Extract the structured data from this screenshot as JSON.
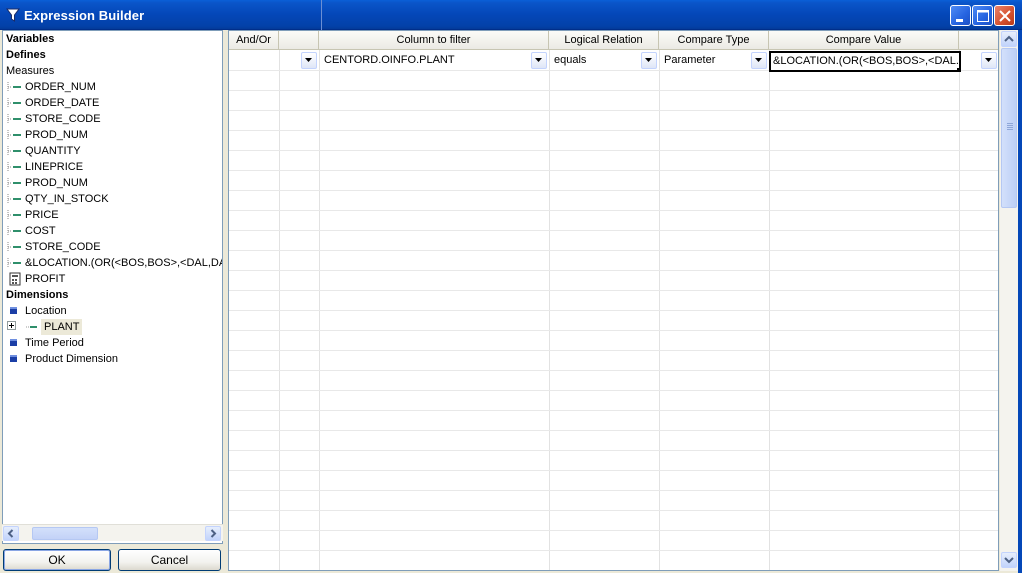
{
  "window": {
    "title": "Expression Builder",
    "title_icon": "funnel-icon",
    "controls": [
      "minimize",
      "maximize",
      "close"
    ]
  },
  "tree": {
    "sections": {
      "variables": "Variables",
      "defines": "Defines",
      "measures": "Measures",
      "dimensions": "Dimensions"
    },
    "measures": [
      {
        "label": "ORDER_NUM",
        "icon": "field-icon"
      },
      {
        "label": "ORDER_DATE",
        "icon": "field-icon"
      },
      {
        "label": "STORE_CODE",
        "icon": "field-icon"
      },
      {
        "label": "PROD_NUM",
        "icon": "field-icon"
      },
      {
        "label": "QUANTITY",
        "icon": "field-icon"
      },
      {
        "label": "LINEPRICE",
        "icon": "field-icon"
      },
      {
        "label": "PROD_NUM",
        "icon": "field-icon"
      },
      {
        "label": "QTY_IN_STOCK",
        "icon": "field-icon"
      },
      {
        "label": "PRICE",
        "icon": "field-icon"
      },
      {
        "label": "COST",
        "icon": "field-icon"
      },
      {
        "label": "STORE_CODE",
        "icon": "field-icon"
      },
      {
        "label": "&LOCATION.(OR(<BOS,BOS>,<DAL,DAL",
        "icon": "field-icon"
      },
      {
        "label": "PROFIT",
        "icon": "calculator-icon"
      }
    ],
    "dimensions": [
      {
        "label": "Location",
        "icon": "dimension-icon"
      },
      {
        "label": "PLANT",
        "icon": "field-icon",
        "child": true,
        "selected": true
      },
      {
        "label": "Time Period",
        "icon": "dimension-icon"
      },
      {
        "label": "Product Dimension",
        "icon": "dimension-icon"
      }
    ]
  },
  "buttons": {
    "ok": "OK",
    "cancel": "Cancel"
  },
  "grid": {
    "columns": [
      "And/Or",
      "",
      "Column to filter",
      "Logical Relation",
      "Compare Type",
      "Compare Value",
      ""
    ],
    "rows": [
      {
        "and_or": "",
        "column": "CENTORD.OINFO.PLANT",
        "relation": "equals",
        "compare_type": "Parameter",
        "compare_value": "&LOCATION.(OR(<BOS,BOS>,<DAL..."
      }
    ]
  },
  "colors": {
    "titlebar": "#0447b8",
    "selection": "#000000",
    "grid_line": "#e8e8e8"
  }
}
